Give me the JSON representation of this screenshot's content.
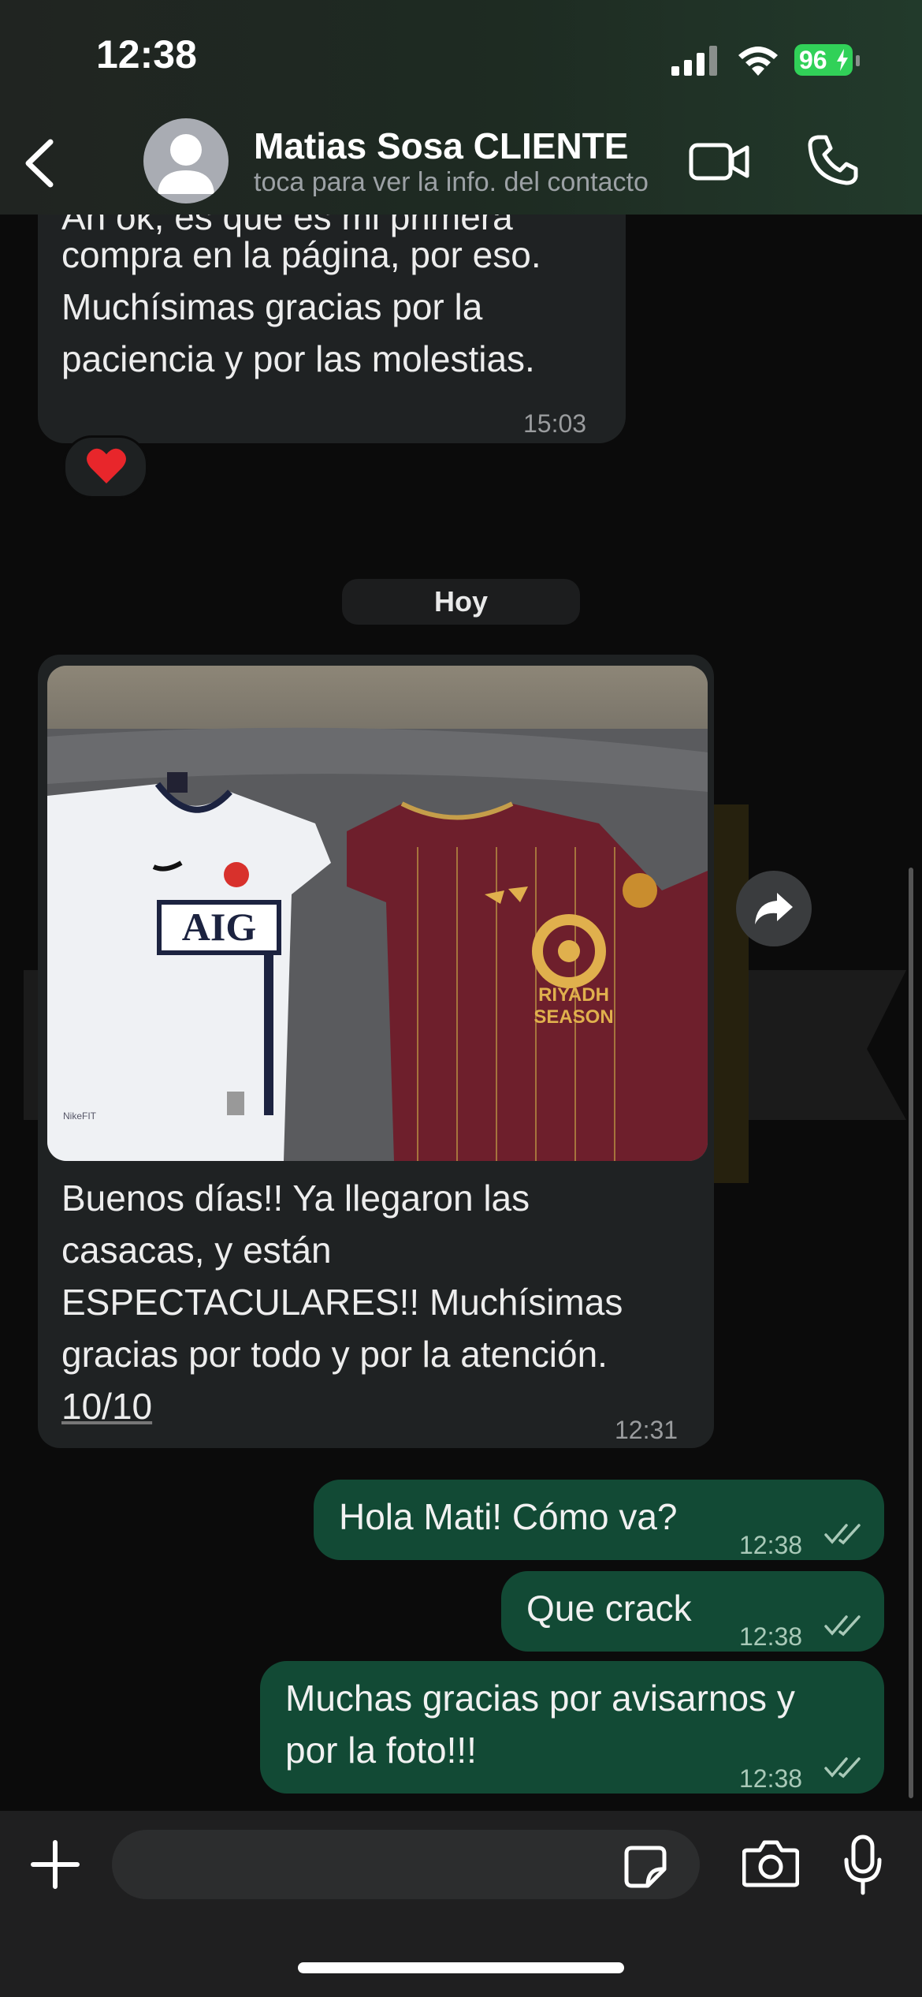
{
  "status_bar": {
    "time": "12:38",
    "battery": "96"
  },
  "header": {
    "contact_name": "Matias Sosa CLIENTE",
    "subtitle": "toca para ver la info. del contacto"
  },
  "messages": {
    "prev": {
      "clipped_line": "Ah ok, es que es mi primera",
      "lines": [
        "compra en la página, por eso.",
        "Muchísimas gracias por la",
        "paciencia y por las molestias."
      ],
      "time": "15:03",
      "reaction": "❤️"
    },
    "date_chip": "Hoy",
    "photo_msg": {
      "lines": [
        "Buenos días!! Ya llegaron las",
        "casacas, y están",
        "ESPECTACULARES!! Muchísimas",
        "gracias por todo y por la atención."
      ],
      "link": "10/10",
      "time": "12:31",
      "photo": {
        "left_shirt_sponsor": "AIG",
        "right_shirt_sponsor_line1": "RIYADH",
        "right_shirt_sponsor_line2": "SEASON",
        "left_tag": "NikeFIT"
      }
    },
    "out1": {
      "text": "Hola Mati! Cómo va?",
      "time": "12:38"
    },
    "out2": {
      "text": "Que crack",
      "time": "12:38"
    },
    "out3": {
      "lines": [
        "Muchas gracias por avisarnos y",
        "por la foto!!!"
      ],
      "time": "12:38"
    }
  },
  "colors": {
    "outgoing": "#124a35",
    "incoming": "#1f2223",
    "battery": "#31d158"
  },
  "icons": [
    "back-icon",
    "avatar-person-icon",
    "video-call-icon",
    "phone-icon",
    "heart-icon",
    "forward-icon",
    "plus-icon",
    "sticker-icon",
    "camera-icon",
    "mic-icon",
    "double-check-icon"
  ]
}
